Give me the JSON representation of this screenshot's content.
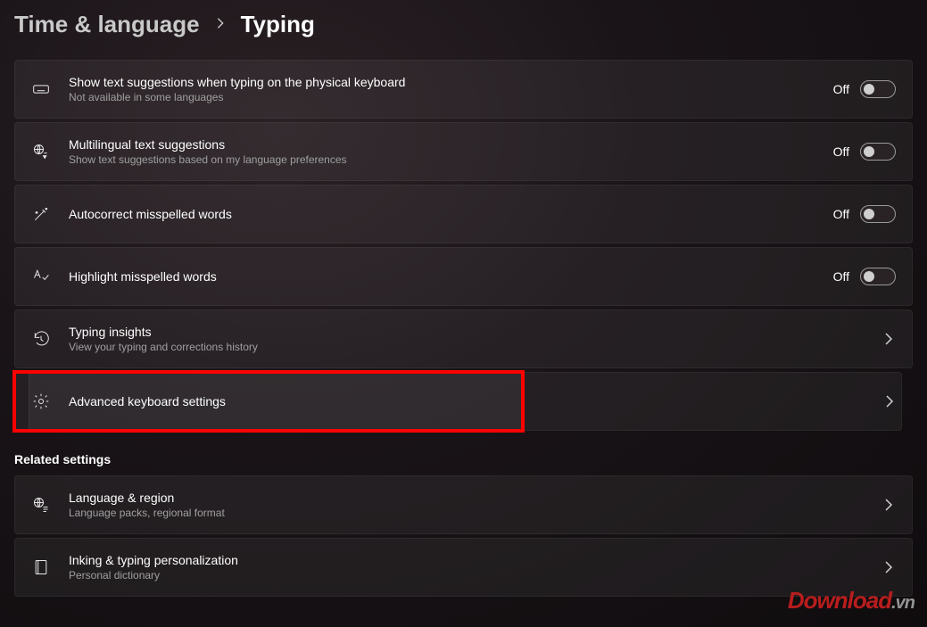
{
  "breadcrumb": {
    "parent": "Time & language",
    "current": "Typing"
  },
  "toggles": {
    "off_label": "Off"
  },
  "rows": {
    "suggestions": {
      "title": "Show text suggestions when typing on the physical keyboard",
      "subtitle": "Not available in some languages"
    },
    "multilingual": {
      "title": "Multilingual text suggestions",
      "subtitle": "Show text suggestions based on my language preferences"
    },
    "autocorrect": {
      "title": "Autocorrect misspelled words"
    },
    "highlight_misspelled": {
      "title": "Highlight misspelled words"
    },
    "insights": {
      "title": "Typing insights",
      "subtitle": "View your typing and corrections history"
    },
    "advanced": {
      "title": "Advanced keyboard settings"
    }
  },
  "related": {
    "header": "Related settings",
    "language_region": {
      "title": "Language & region",
      "subtitle": "Language packs, regional format"
    },
    "inking": {
      "title": "Inking & typing personalization",
      "subtitle": "Personal dictionary"
    }
  },
  "watermark": {
    "main": "Download",
    "suffix": ".vn"
  }
}
